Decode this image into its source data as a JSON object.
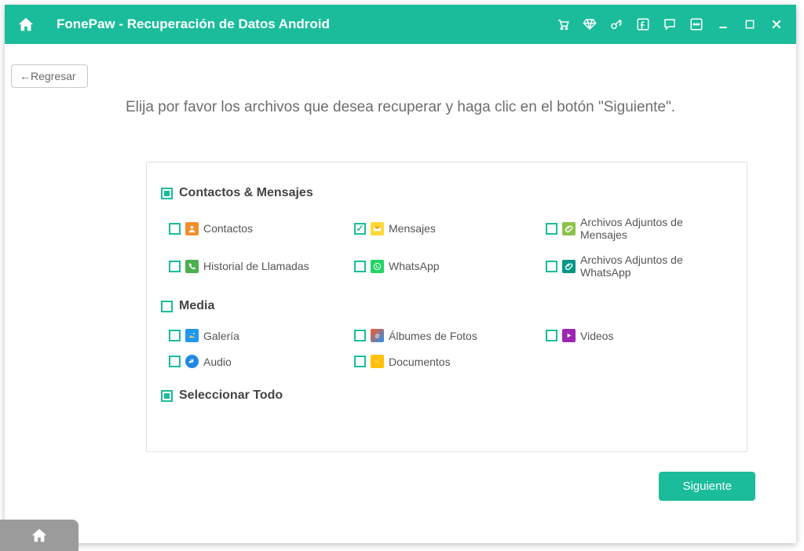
{
  "titlebar": {
    "title": "FonePaw - Recuperación de Datos Android"
  },
  "back_label": "Regresar",
  "instruction": "Elija por favor los archivos que desea recuperar y haga clic en el botón \"Siguiente\".",
  "section1": {
    "title": "Contactos & Mensajes",
    "state": "indeterminate",
    "items": [
      {
        "label": "Contactos",
        "checked": false,
        "icon": "contacts",
        "col": 1
      },
      {
        "label": "Mensajes",
        "checked": true,
        "icon": "messages",
        "col": 2
      },
      {
        "label": "Archivos Adjuntos de Mensajes",
        "checked": false,
        "icon": "attach-msg",
        "col": 3
      },
      {
        "label": "Historial de Llamadas",
        "checked": false,
        "icon": "calls",
        "col": 1
      },
      {
        "label": "WhatsApp",
        "checked": false,
        "icon": "whatsapp",
        "col": 2
      },
      {
        "label": "Archivos Adjuntos de WhatsApp",
        "checked": false,
        "icon": "attach-wa",
        "col": 3
      }
    ]
  },
  "section2": {
    "title": "Media",
    "state": "unchecked",
    "items": [
      {
        "label": "Galería",
        "checked": false,
        "icon": "gallery",
        "col": 1
      },
      {
        "label": "Álbumes de Fotos",
        "checked": false,
        "icon": "albums",
        "col": 2
      },
      {
        "label": "Videos",
        "checked": false,
        "icon": "videos",
        "col": 3
      },
      {
        "label": "Audio",
        "checked": false,
        "icon": "audio",
        "col": 1
      },
      {
        "label": "Documentos",
        "checked": false,
        "icon": "documents",
        "col": 2
      }
    ]
  },
  "select_all": {
    "label": "Seleccionar Todo",
    "state": "indeterminate"
  },
  "next_label": "Siguiente"
}
